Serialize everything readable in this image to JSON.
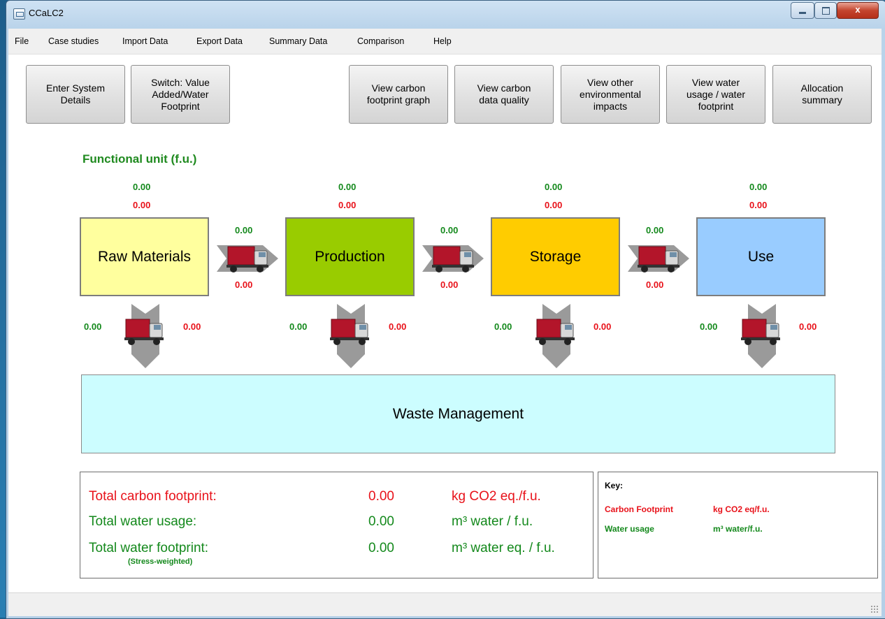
{
  "window": {
    "title": "CCaLC2",
    "close_symbol": "x"
  },
  "menu": [
    "File",
    "Case studies",
    "Import Data",
    "Export Data",
    "Summary Data",
    "Comparison",
    "Help"
  ],
  "toolbar": {
    "enter_system_details": "Enter System\nDetails",
    "switch_value": "Switch: Value\nAdded/Water\nFootprint",
    "view_carbon_graph": "View carbon\nfootprint graph",
    "view_carbon_quality": "View carbon\ndata quality",
    "view_other_impacts": "View other\nenvironmental\nimpacts",
    "view_water": "View water\nusage / water\nfootprint",
    "allocation_summary": "Allocation\nsummary"
  },
  "functional_unit_label": "Functional unit (f.u.)",
  "stages": [
    {
      "name": "Raw Materials",
      "top_green": "0.00",
      "top_red": "0.00",
      "color": "#ffff9e",
      "waste_green": "0.00",
      "waste_red": "0.00"
    },
    {
      "name": "Production",
      "top_green": "0.00",
      "top_red": "0.00",
      "color": "#99cc00",
      "waste_green": "0.00",
      "waste_red": "0.00"
    },
    {
      "name": "Storage",
      "top_green": "0.00",
      "top_red": "0.00",
      "color": "#ffcc00",
      "waste_green": "0.00",
      "waste_red": "0.00"
    },
    {
      "name": "Use",
      "top_green": "0.00",
      "top_red": "0.00",
      "color": "#99ccff",
      "waste_green": "0.00",
      "waste_red": "0.00"
    }
  ],
  "transports": [
    {
      "green": "0.00",
      "red": "0.00"
    },
    {
      "green": "0.00",
      "red": "0.00"
    },
    {
      "green": "0.00",
      "red": "0.00"
    }
  ],
  "waste_label": "Waste Management",
  "totals": {
    "carbon_label": "Total carbon footprint:",
    "carbon_value": "0.00",
    "carbon_unit": "kg CO2 eq./f.u.",
    "water_usage_label": "Total water usage:",
    "water_usage_value": "0.00",
    "water_usage_unit": "m³ water / f.u.",
    "water_fp_label": "Total water footprint:",
    "water_fp_sub": "(Stress-weighted)",
    "water_fp_value": "0.00",
    "water_fp_unit": "m³ water eq. / f.u."
  },
  "key": {
    "title": "Key:",
    "carbon_label": "Carbon Footprint",
    "carbon_unit": "kg CO2 eq/f.u.",
    "water_label": "Water usage",
    "water_unit": "m³ water/f.u."
  },
  "colors": {
    "green_text": "#14891c",
    "red_text": "#e8121a",
    "waste_fill": "#ccfdff"
  }
}
